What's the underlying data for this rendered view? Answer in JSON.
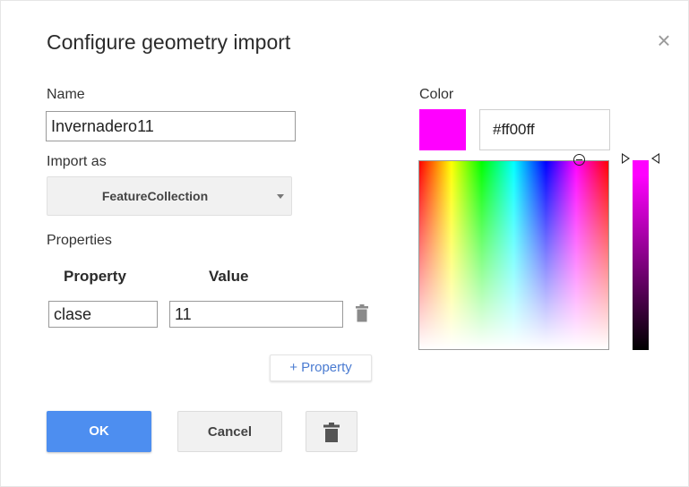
{
  "dialog": {
    "title": "Configure geometry import",
    "close_icon": "close-icon"
  },
  "name": {
    "label": "Name",
    "value": "Invernadero11"
  },
  "import_as": {
    "label": "Import as",
    "selected": "FeatureCollection",
    "icon": "chevron-down-icon"
  },
  "properties": {
    "label": "Properties",
    "col_property": "Property",
    "col_value": "Value",
    "rows": [
      {
        "property": "clase",
        "value": "11"
      }
    ],
    "add_label": "+ Property",
    "delete_icon": "trash-icon"
  },
  "color": {
    "label": "Color",
    "hex": "#ff00ff",
    "swatch_color": "#ff00ff"
  },
  "buttons": {
    "ok": "OK",
    "cancel": "Cancel",
    "delete_icon": "trash-icon"
  }
}
